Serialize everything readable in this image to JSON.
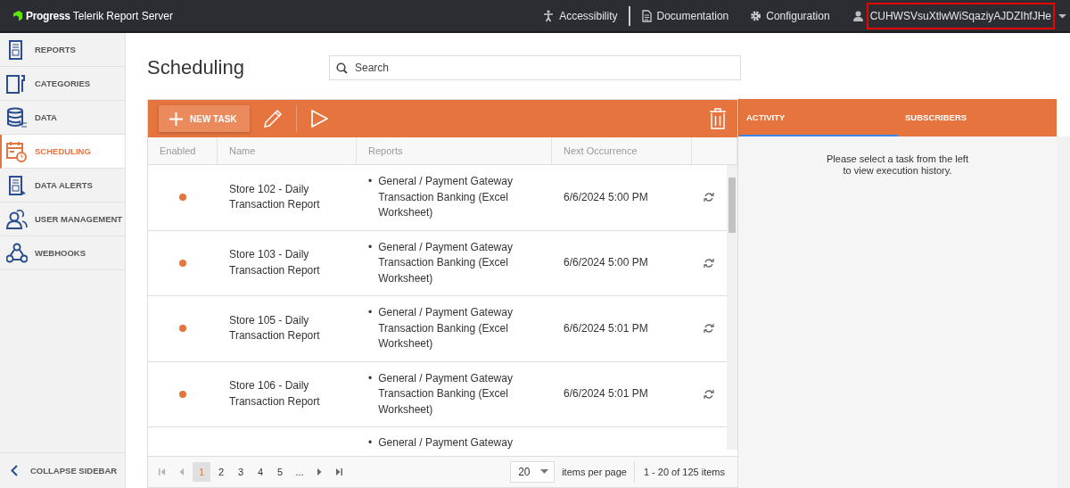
{
  "topbar": {
    "logo": "Progress",
    "product": "Telerik",
    "product_name": "Report Server",
    "links": [
      {
        "kind": "accessibility",
        "label": "Accessibility"
      },
      {
        "kind": "documentation",
        "label": "Documentation"
      },
      {
        "kind": "configuration",
        "label": "Configuration"
      }
    ],
    "user": "CUHWSVsuXtlwWiSqaziyAJDZIhfJHe"
  },
  "sidebar": {
    "items": [
      {
        "kind": "reports",
        "label": "REPORTS",
        "selected": false
      },
      {
        "kind": "categories",
        "label": "CATEGORIES",
        "selected": false
      },
      {
        "kind": "data",
        "label": "DATA",
        "selected": false
      },
      {
        "kind": "scheduling",
        "label": "SCHEDULING",
        "selected": true
      },
      {
        "kind": "alerts",
        "label": "DATA ALERTS",
        "selected": false
      },
      {
        "kind": "users",
        "label": "USER MANAGEMENT",
        "selected": false
      },
      {
        "kind": "webhooks",
        "label": "WEBHOOKS",
        "selected": false
      }
    ],
    "collapse": "COLLAPSE SIDEBAR"
  },
  "page": {
    "title": "Scheduling",
    "search": {
      "placeholder": "Search"
    }
  },
  "toolbar": {
    "new_task": "NEW TASK"
  },
  "table": {
    "columns": [
      "Enabled",
      "Name",
      "Reports",
      "Next Occurrence"
    ],
    "rows": [
      {
        "enabled": true,
        "name": "Store 102 - Daily Transaction Report",
        "reports": [
          {
            "bullet": "•",
            "text": "General / Payment Gateway Transaction Banking (Excel Worksheet)"
          }
        ],
        "next": "6/6/2024 5:00 PM",
        "recurring": true
      },
      {
        "enabled": true,
        "name": "Store 103 - Daily Transaction Report",
        "reports": [
          {
            "bullet": "•",
            "text": "General / Payment Gateway Transaction Banking (Excel Worksheet)"
          }
        ],
        "next": "6/6/2024 5:00 PM",
        "recurring": true
      },
      {
        "enabled": true,
        "name": "Store 105 - Daily Transaction Report",
        "reports": [
          {
            "bullet": "•",
            "text": "General / Payment Gateway Transaction Banking (Excel Worksheet)"
          }
        ],
        "next": "6/6/2024 5:01 PM",
        "recurring": true
      },
      {
        "enabled": true,
        "name": "Store 106 - Daily Transaction Report",
        "reports": [
          {
            "bullet": "•",
            "text": "General / Payment Gateway Transaction Banking (Excel Worksheet)"
          }
        ],
        "next": "6/6/2024 5:01 PM",
        "recurring": true
      },
      {
        "reports": [
          {
            "bullet": "•",
            "text": "General / Payment Gateway"
          }
        ]
      }
    ]
  },
  "pager": {
    "pages": [
      {
        "label": "1",
        "selected": true
      },
      {
        "label": "2",
        "selected": false
      },
      {
        "label": "3",
        "selected": false
      },
      {
        "label": "4",
        "selected": false
      },
      {
        "label": "5",
        "selected": false
      },
      {
        "label": "...",
        "selected": false
      }
    ],
    "page_size": "20",
    "per_page_label": "items per page",
    "info": "1 - 20 of 125 items"
  },
  "details": {
    "tabs": [
      {
        "label": "ACTIVITY",
        "selected": true
      },
      {
        "label": "SUBSCRIBERS",
        "selected": false
      }
    ],
    "message": "Please select a task from the left to view execution history."
  }
}
